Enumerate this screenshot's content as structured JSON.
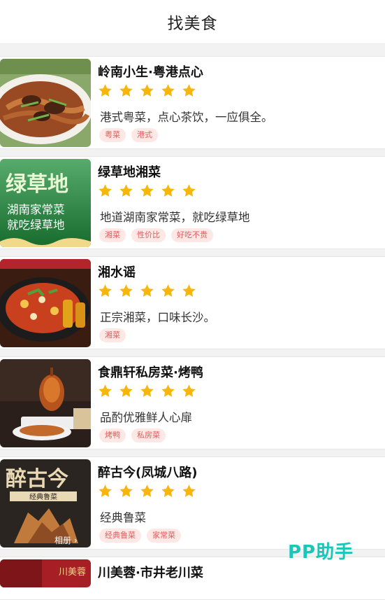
{
  "header": {
    "title": "找美食"
  },
  "restaurants": [
    {
      "name": "岭南小生·粤港点心",
      "desc": "港式粤菜，点心茶饮，一应俱全。",
      "tags": [
        "粤菜",
        "港式"
      ],
      "rating": 5
    },
    {
      "name": "绿草地湘菜",
      "desc": "地道湖南家常菜，就吃绿草地",
      "tags": [
        "湘菜",
        "性价比",
        "好吃不贵"
      ],
      "rating": 5,
      "thumb_text": {
        "logo": "绿草地",
        "line1": "湖南家常菜",
        "line2": "就吃绿草地"
      }
    },
    {
      "name": "湘水谣",
      "desc": "正宗湘菜，口味长沙。",
      "tags": [
        "湘菜"
      ],
      "rating": 5
    },
    {
      "name": "食鼎轩私房菜·烤鸭",
      "desc": "品酌优雅鲜人心扉",
      "tags": [
        "烤鸭",
        "私房菜"
      ],
      "rating": 5
    },
    {
      "name": "醉古今(凤城八路)",
      "desc": "经典鲁菜",
      "tags": [
        "经典鲁菜",
        "家常菜"
      ],
      "rating": 5,
      "thumb_text": {
        "logo": "醉古今",
        "sub": "经典鲁菜",
        "gallery": "相册 ›"
      }
    },
    {
      "name": "川美蓉·市井老川菜",
      "thumb_text": {
        "badge": "川美蓉"
      }
    }
  ],
  "watermark": "PP助手",
  "colors": {
    "star": "#f6b60c",
    "tag_text": "#e35a5a",
    "tag_bg": "#fde8e6",
    "watermark": "#19c6b8"
  }
}
